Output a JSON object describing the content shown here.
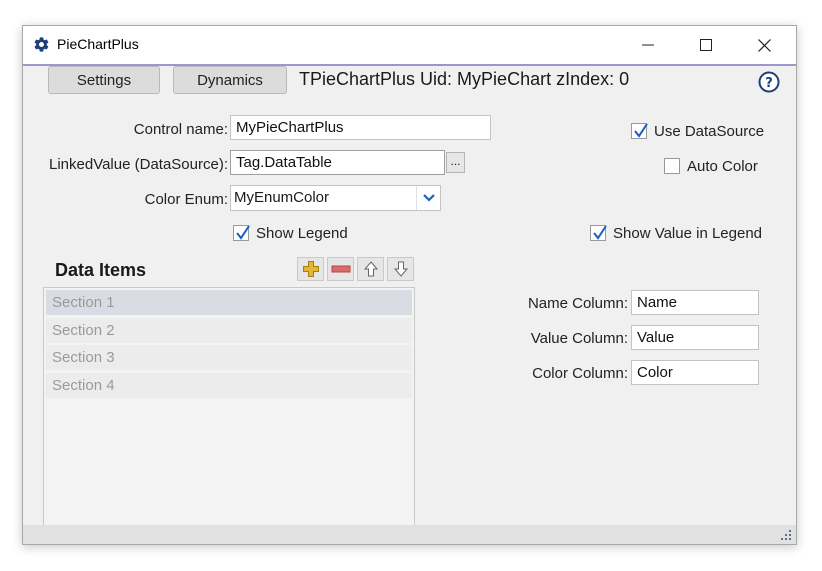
{
  "window": {
    "title": "PieChartPlus"
  },
  "tabs": [
    {
      "label": "Settings"
    },
    {
      "label": "Dynamics"
    }
  ],
  "header": {
    "text": "TPieChartPlus Uid: MyPieChart zIndex: 0"
  },
  "form": {
    "control_name": {
      "label": "Control name:",
      "value": "MyPieChartPlus"
    },
    "linked_value": {
      "label": "LinkedValue (DataSource):",
      "value": "Tag.DataTable",
      "browse_label": "..."
    },
    "color_enum": {
      "label": "Color Enum:",
      "value": "MyEnumColor"
    }
  },
  "options": {
    "use_datasource": {
      "label": "Use DataSource",
      "checked": true
    },
    "auto_color": {
      "label": "Auto Color",
      "checked": false
    },
    "show_legend": {
      "label": "Show Legend",
      "checked": true
    },
    "show_value_in_legend": {
      "label": "Show Value in Legend",
      "checked": true
    }
  },
  "data_items": {
    "title": "Data Items",
    "items": [
      "Section 1",
      "Section 2",
      "Section 3",
      "Section 4"
    ],
    "selected_index": 0
  },
  "columns": {
    "name": {
      "label": "Name Column:",
      "value": "Name"
    },
    "value": {
      "label": "Value Column:",
      "value": "Value"
    },
    "color": {
      "label": "Color Column:",
      "value": "Color"
    }
  },
  "colors": {
    "accent": "#9e97c9",
    "check": "#1b5fc1",
    "add": "#e2b634",
    "remove": "#d96b6b",
    "help": "#1d3f7a"
  },
  "icons": {
    "app": "gear-icon",
    "help": "help-icon",
    "add": "add-icon",
    "remove": "remove-icon",
    "up": "arrow-up-icon",
    "down": "arrow-down-icon"
  }
}
